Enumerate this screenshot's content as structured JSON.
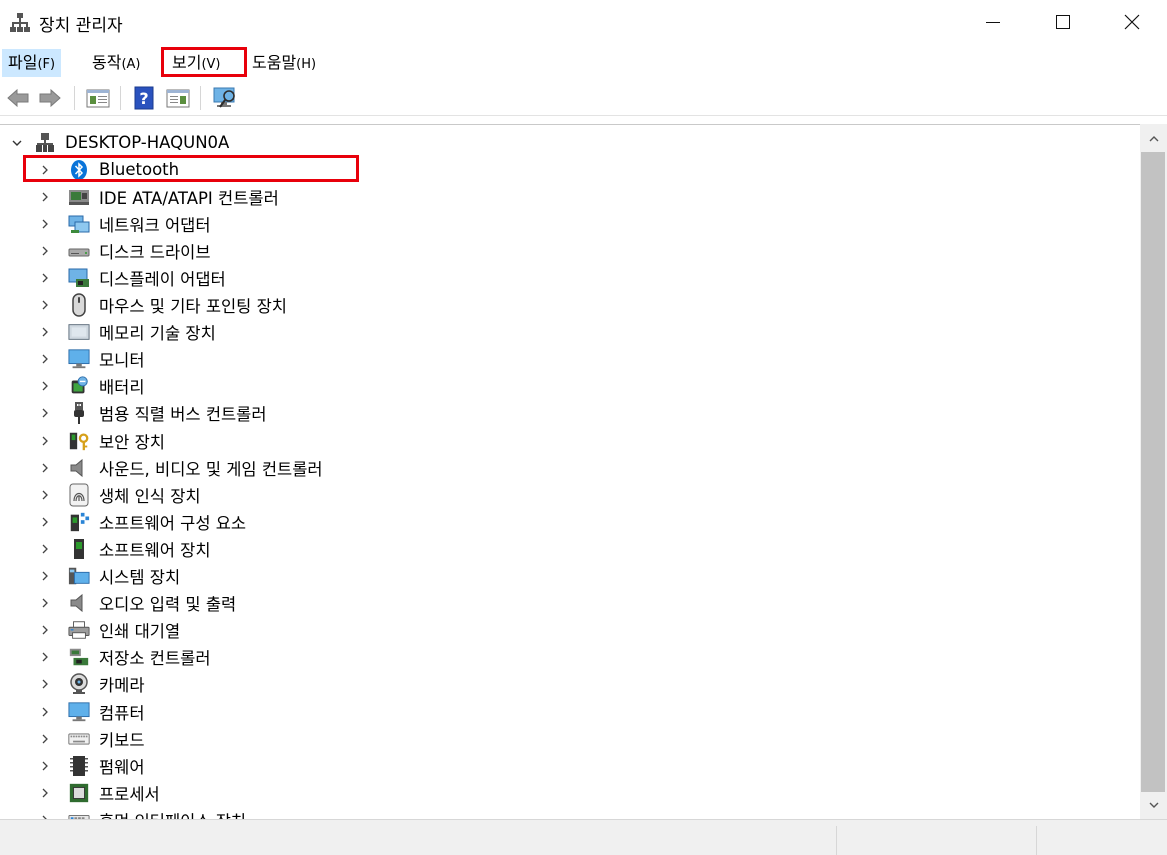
{
  "window": {
    "title": "장치 관리자",
    "icons": {
      "app": "device-manager-icon",
      "minimize": "minimize-icon",
      "maximize": "maximize-icon",
      "close": "close-icon"
    }
  },
  "menu": [
    {
      "label": "파일",
      "accel": "(F)"
    },
    {
      "label": "동작",
      "accel": "(A)"
    },
    {
      "label": "보기",
      "accel": "(V)"
    },
    {
      "label": "도움말",
      "accel": "(H)"
    }
  ],
  "toolbar": [
    "back-arrow-icon",
    "forward-arrow-icon",
    "show-hide-console-tree-icon",
    "help-icon",
    "properties-pane-icon",
    "scan-hardware-icon"
  ],
  "tree": {
    "root": "DESKTOP-HAQUN0A",
    "items": [
      {
        "label": "Bluetooth",
        "icon": "bluetooth-icon"
      },
      {
        "label": "IDE ATA/ATAPI 컨트롤러",
        "icon": "ide-controller-icon"
      },
      {
        "label": "네트워크 어댑터",
        "icon": "network-adapter-icon"
      },
      {
        "label": "디스크 드라이브",
        "icon": "disk-drive-icon"
      },
      {
        "label": "디스플레이 어댑터",
        "icon": "display-adapter-icon"
      },
      {
        "label": "마우스 및 기타 포인팅 장치",
        "icon": "mouse-icon"
      },
      {
        "label": "메모리 기술 장치",
        "icon": "memory-device-icon"
      },
      {
        "label": "모니터",
        "icon": "monitor-icon"
      },
      {
        "label": "배터리",
        "icon": "battery-icon"
      },
      {
        "label": "범용 직렬 버스 컨트롤러",
        "icon": "usb-icon"
      },
      {
        "label": "보안 장치",
        "icon": "security-device-icon"
      },
      {
        "label": "사운드, 비디오 및 게임 컨트롤러",
        "icon": "speaker-icon"
      },
      {
        "label": "생체 인식 장치",
        "icon": "fingerprint-icon"
      },
      {
        "label": "소프트웨어 구성 요소",
        "icon": "software-component-icon"
      },
      {
        "label": "소프트웨어 장치",
        "icon": "software-device-icon"
      },
      {
        "label": "시스템 장치",
        "icon": "system-device-icon"
      },
      {
        "label": "오디오 입력 및 출력",
        "icon": "audio-io-icon"
      },
      {
        "label": "인쇄 대기열",
        "icon": "printer-icon"
      },
      {
        "label": "저장소 컨트롤러",
        "icon": "storage-controller-icon"
      },
      {
        "label": "카메라",
        "icon": "camera-icon"
      },
      {
        "label": "컴퓨터",
        "icon": "computer-icon"
      },
      {
        "label": "키보드",
        "icon": "keyboard-icon"
      },
      {
        "label": "펌웨어",
        "icon": "firmware-icon"
      },
      {
        "label": "프로세서",
        "icon": "processor-icon"
      },
      {
        "label": "휴먼 인터페이스 장치",
        "icon": "hid-icon"
      }
    ]
  },
  "colors": {
    "highlight": "#e8000b",
    "bluetooth": "#0078d7"
  }
}
